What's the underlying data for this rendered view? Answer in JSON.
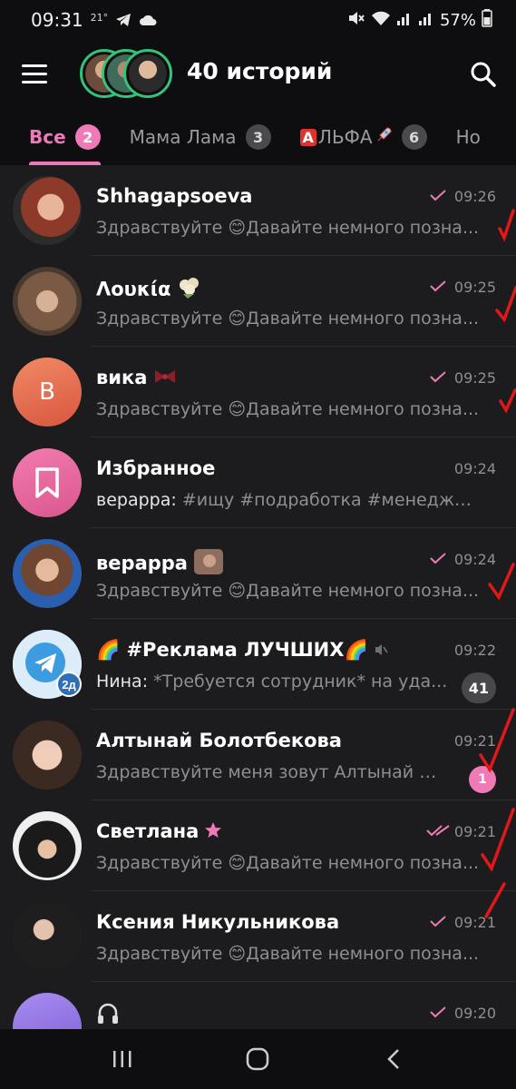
{
  "status_bar": {
    "time": "09:31",
    "temperature": "21°",
    "battery": "57%"
  },
  "header": {
    "title": "40 историй"
  },
  "tabs": [
    {
      "label": "Все",
      "badge": "2",
      "active": true
    },
    {
      "label": "Мама Лама",
      "badge": "3",
      "active": false
    },
    {
      "label": "ЛЬФА",
      "prefix_letter": "А",
      "badge": "6",
      "active": false
    },
    {
      "label": "Но",
      "badge": "",
      "active": false
    }
  ],
  "chats": [
    {
      "name": "Shhagapsoeva",
      "preview": "Здравствуйте 😊Давайте немного позна...",
      "time": "09:26",
      "status": "sent"
    },
    {
      "name": "Λουκία",
      "preview": "Здравствуйте 😊Давайте немного позна...",
      "time": "09:25",
      "status": "sent"
    },
    {
      "name": "вика",
      "avatar_letter": "В",
      "preview": "Здравствуйте 😊Давайте немного позна...",
      "time": "09:25",
      "status": "sent"
    },
    {
      "name": "Избранное",
      "sender": "верарра:",
      "preview": " #ищу #подработка #менеджер...",
      "time": "09:24",
      "status": ""
    },
    {
      "name": "верарра",
      "preview": "Здравствуйте 😊Давайте немного позна...",
      "time": "09:24",
      "status": "sent"
    },
    {
      "name": "🌈 #Реклама ЛУЧШИХ🌈",
      "sender": "Нина:",
      "preview": " *Требуется сотрудник* на уда...",
      "time": "09:22",
      "counter": "41",
      "avatar_badge": "2д"
    },
    {
      "name": "Алтынай Болотбекова",
      "preview": "Здравствуйте меня зовут Алтынай я...",
      "time": "09:21",
      "counter": "1"
    },
    {
      "name": "Светлана",
      "preview": "Здравствуйте 😊Давайте немного позна...",
      "time": "09:21",
      "status": "read"
    },
    {
      "name": "Ксения Никульникова",
      "preview": "Здравствуйте 😊Давайте немного позна...",
      "time": "09:21",
      "status": "sent"
    },
    {
      "name": "",
      "preview": "",
      "time": "09:20",
      "status": "sent"
    }
  ],
  "colors": {
    "accent": "#f07ab7",
    "background": "#1c1c1e",
    "bar": "#0e0e10"
  }
}
